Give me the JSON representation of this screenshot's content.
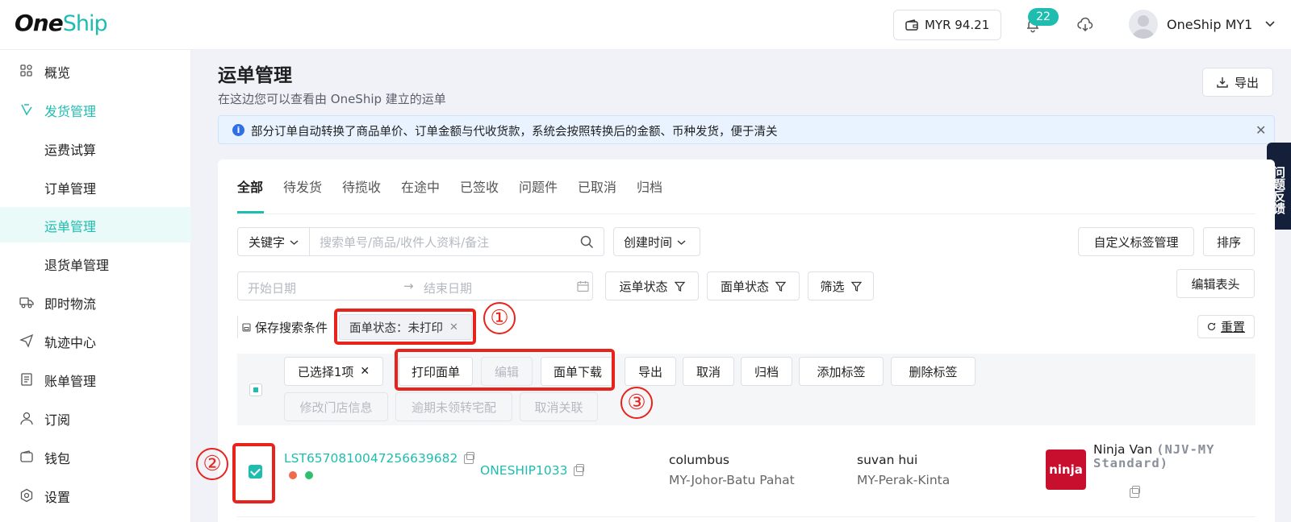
{
  "header": {
    "logo_one": "One",
    "logo_ship": "Ship",
    "wallet_amount": "MYR 94.21",
    "notification_count": "22",
    "user_name": "OneShip MY1"
  },
  "sidebar": {
    "items": [
      {
        "label": "概览",
        "icon": "grid-icon"
      },
      {
        "label": "发货管理",
        "icon": "ship-icon"
      },
      {
        "label": "运费试算"
      },
      {
        "label": "订单管理"
      },
      {
        "label": "运单管理"
      },
      {
        "label": "退货单管理"
      },
      {
        "label": "即时物流",
        "icon": "truck-icon"
      },
      {
        "label": "轨迹中心",
        "icon": "send-icon"
      },
      {
        "label": "账单管理",
        "icon": "bill-icon"
      },
      {
        "label": "订阅",
        "icon": "user-icon"
      },
      {
        "label": "钱包",
        "icon": "wallet-icon"
      },
      {
        "label": "设置",
        "icon": "settings-icon"
      }
    ]
  },
  "page": {
    "title": "运单管理",
    "subtitle": "在这边您可以查看由 OneShip 建立的运单",
    "export_label": "导出",
    "notice": "部分订单自动转换了商品单价、订单金额与代收货款，系统会按照转换后的金额、币种发货，便于清关",
    "feedback": "问题反馈"
  },
  "tabs": [
    "全部",
    "待发货",
    "待揽收",
    "在途中",
    "已签收",
    "问题件",
    "已取消",
    "归档"
  ],
  "filters": {
    "keyword_select": "关键字",
    "search_placeholder": "搜索单号/商品/收件人资料/备注",
    "time_select": "创建时间",
    "tag_manage": "自定义标签管理",
    "sort": "排序",
    "start_date": "开始日期",
    "end_date": "结束日期",
    "waybill_status": "运单状态",
    "label_status": "面单状态",
    "filter": "筛选",
    "edit_header": "编辑表头",
    "save_search": "保存搜索条件",
    "chip": "面单状态：未打印",
    "reset": "重置"
  },
  "batch": {
    "selected": "已选择1项",
    "print": "打印面单",
    "edit": "编辑",
    "download": "面单下载",
    "export": "导出",
    "cancel": "取消",
    "archive": "归档",
    "add_tag": "添加标签",
    "remove_tag": "删除标签",
    "edit_store": "修改门店信息",
    "overdue": "逾期未领转宅配",
    "unlink": "取消关联"
  },
  "row": {
    "tracking": "LST6570810047256639682",
    "order_id": "ONESHIP1033",
    "sender_name": "columbus",
    "sender_region": "MY-Johor-Batu Pahat",
    "receiver_name": "suvan hui",
    "receiver_region": "MY-Perak-Kinta",
    "carrier_logo": "ninja",
    "carrier_name": "Ninja Van",
    "carrier_code": "(NJV-MY Standard)",
    "status_dot_colors": [
      "#ef6b4c",
      "#2fbf71"
    ]
  },
  "annotations": [
    "①",
    "②",
    "③"
  ],
  "colors": {
    "accent": "#1fbcb0",
    "annotation": "#e8231c"
  }
}
